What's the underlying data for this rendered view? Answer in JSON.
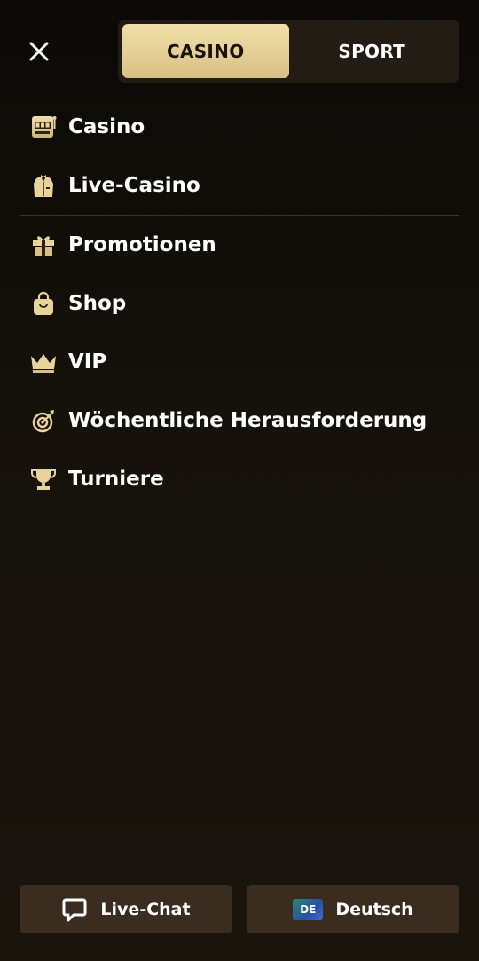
{
  "header": {
    "close_icon": "close-icon",
    "tabs": [
      {
        "label": "CASINO",
        "active": true
      },
      {
        "label": "SPORT",
        "active": false
      }
    ]
  },
  "menu": {
    "items": [
      {
        "label": "Casino",
        "icon": "slot-machine-icon"
      },
      {
        "label": "Live-Casino",
        "icon": "dealer-icon"
      },
      {
        "label": "Promotionen",
        "icon": "gift-icon"
      },
      {
        "label": "Shop",
        "icon": "shopping-bag-icon"
      },
      {
        "label": "VIP",
        "icon": "crown-icon"
      },
      {
        "label": "Wöchentliche Herausforderung",
        "icon": "target-icon"
      },
      {
        "label": "Turniere",
        "icon": "trophy-icon"
      }
    ]
  },
  "footer": {
    "live_chat_label": "Live-Chat",
    "language_label": "Deutsch",
    "language_code": "DE"
  },
  "colors": {
    "accent_gold": "#e8d49b",
    "background": "#15110b",
    "button_bg": "#3b2c20"
  }
}
